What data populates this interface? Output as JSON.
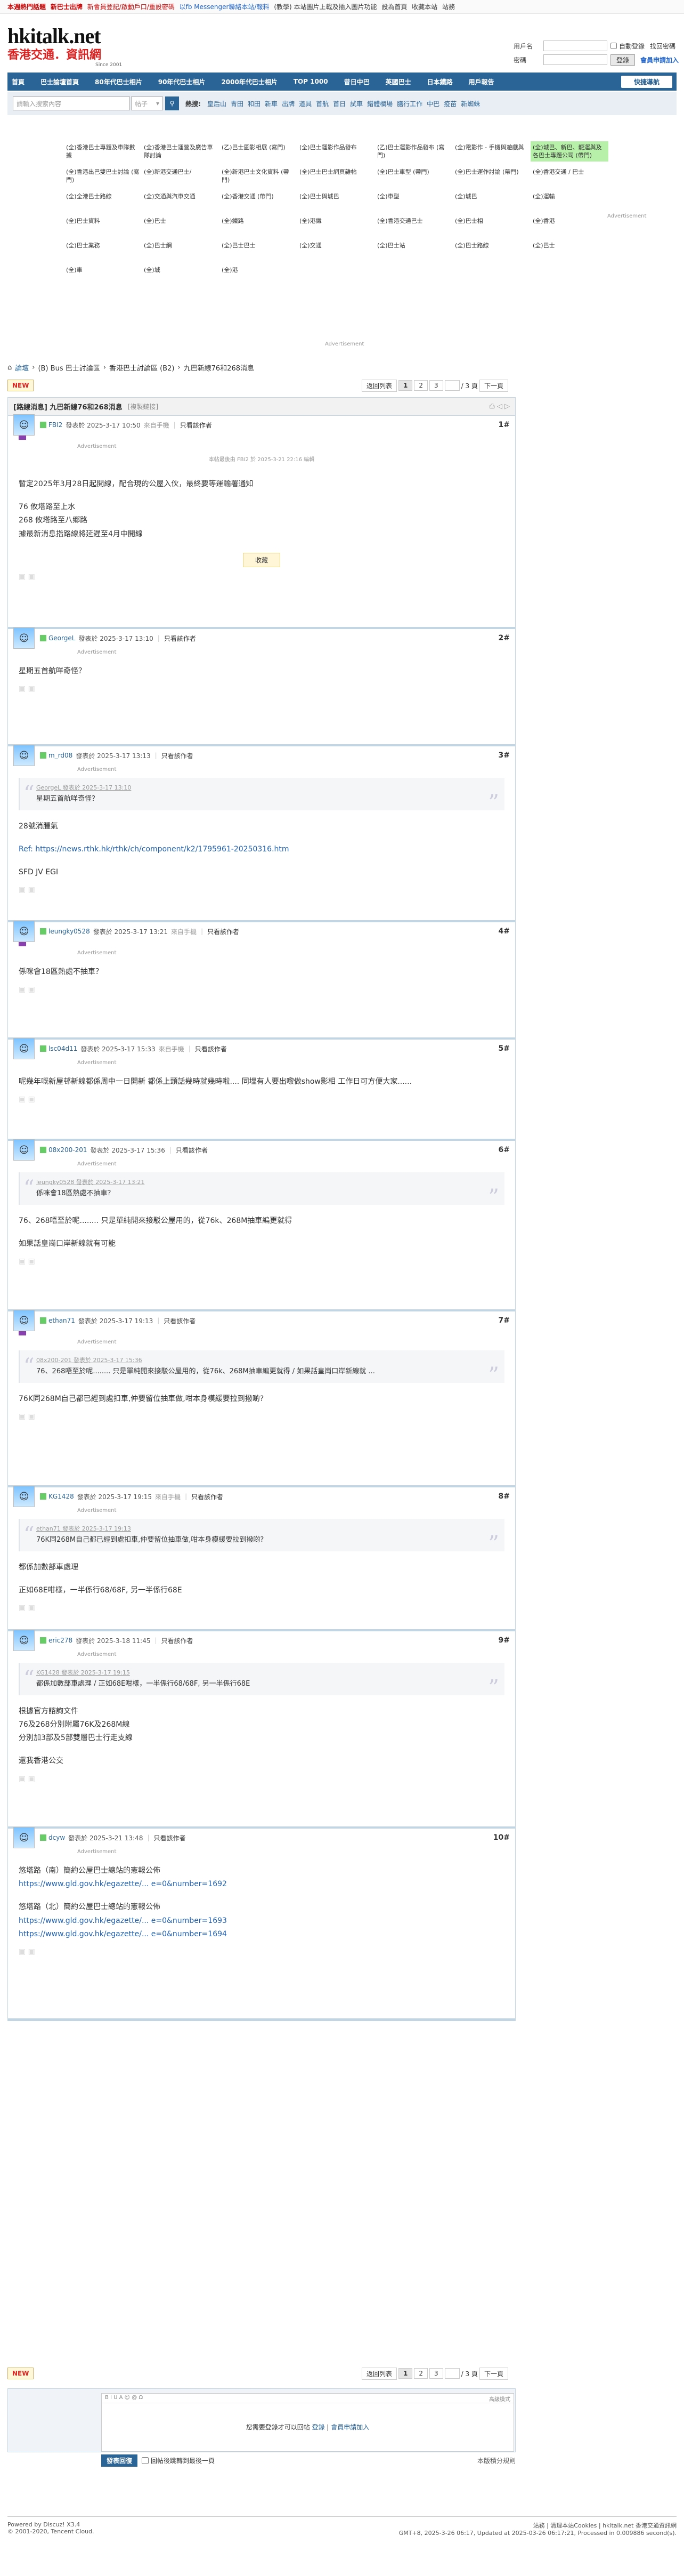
{
  "topbar": {
    "items": [
      "本週熱門話題",
      "新巴士出牌",
      "新會員登記/啟動戶口/重設密碼",
      "以fb Messenger聯絡本站/報料",
      "(教學) 本站圖片上載及插入圖片功能",
      "設為首頁",
      "收藏本站",
      "站務"
    ]
  },
  "logo": {
    "main": "hkitalk.net",
    "sub": "香港交通．資訊網",
    "date": "Since 2001"
  },
  "login": {
    "user_label": "用戶名",
    "pass_label": "密碼",
    "auto": "自動登錄",
    "find": "找回密碼",
    "login_btn": "登錄",
    "register": "會員申請加入"
  },
  "nav": {
    "items": [
      "首頁",
      "巴士論壇首頁",
      "80年代巴士相片",
      "90年代巴士相片",
      "2000年代巴士相片",
      "TOP 1000",
      "昔日中巴",
      "英國巴士",
      "日本鐵路",
      "用戶報告"
    ],
    "quick": "快捷導航"
  },
  "search": {
    "placeholder": "請輸入搜索內容",
    "select": "帖子",
    "hot_label": "熱搜:",
    "hot": [
      "皇后山",
      "青田",
      "和田",
      "新車",
      "出牌",
      "道具",
      "首航",
      "首日",
      "試車",
      "錯體欄場",
      "膳行工作",
      "中巴",
      "疫苗",
      "新蜘蛛"
    ]
  },
  "adlinks": [
    "(全)香港巴士專題及車隊數據",
    "(全)香港巴士運營及廣告車隊討論",
    "(乙)巴士圖影相展 (寫門)",
    "(全)巴士運影作品發布",
    "(乙)巴士運影作品發布 (寫門)",
    "(全)電影作 - 手機與遊戲與",
    "(全)香港出巴雙巴士討論 (寫門)",
    "(全)新港交通巴士/",
    "(全)新港巴士文化資料 (帶門)",
    "(全)巴士巴士網頁雜帖",
    "(全)巴士車型 (帶門)",
    "(全)巴士運作討論 (帶門)",
    "(全)香港交通 / 巴士",
    "(全)全港巴士路線",
    "(全)交通與汽車交通",
    "(全)香港交通 (帶門)",
    "(全)巴士與城巴",
    "(全)車型",
    "(全)城巴",
    "(全)運輸",
    "(全)巴士資料",
    "(全)巴士",
    "(全)鐵路",
    "(全)港鐵",
    "(全)香港交通巴士",
    "(全)巴士相",
    "(全)香港",
    "(全)巴士業務",
    "(全)巴士網",
    "(全)巴士巴士",
    "(全)交通",
    "(全)巴士站",
    "(全)巴士路線",
    "(全)巴士",
    "(全)車",
    "(全)城",
    "(全)港"
  ],
  "adlinks_highlight": "(全)城巴、新巴、龍運與及各巴士專題公司 (帶門)",
  "crumb": {
    "home": "論壇",
    "items": [
      "(B) Bus 巴士討論區",
      "香港巴士討論區 (B2)",
      "九巴新線76和268消息"
    ]
  },
  "pagebar": {
    "new": "NEW",
    "back": "返回列表",
    "pages": [
      "1",
      "2",
      "3"
    ],
    "total": "/ 3 頁",
    "next": "下一頁"
  },
  "thread": {
    "title": "[路線消息] 九巴新線76和268消息",
    "category": "[複製鏈接]"
  },
  "posts": [
    {
      "user": "FBI2",
      "time": "發表於 2025-3-17 10:50",
      "from": "來自手機",
      "only": "只看該作者",
      "floor": "1#",
      "edit": "本帖最後由 FBI2 於 2025-3-21 22:16 編輯",
      "lines": [
        "暫定2025年3月28日起開線，配合現的公屋入伙，最終要等運輸署通知",
        "",
        "76 攸塔路至上水",
        "268 攸塔路至八鄉路",
        "據最新消息指路線將延遲至4月中開線"
      ],
      "collect": "收藏"
    },
    {
      "user": "GeorgeL",
      "time": "發表於 2025-3-17 13:10",
      "only": "只看該作者",
      "floor": "2#",
      "lines": [
        "星期五首航咩奇怪？"
      ]
    },
    {
      "user": "m_rd08",
      "time": "發表於 2025-3-17 13:13",
      "only": "只看該作者",
      "floor": "3#",
      "quote_head": "GeorgeL 發表於 2025-3-17 13:10",
      "quote": "星期五首航咩奇怪？",
      "lines": [
        "28號消腫氣",
        "",
        "Ref: https://news.rthk.hk/rthk/ch/component/k2/1795961-20250316.htm",
        "",
        "SFD JV EGI"
      ]
    },
    {
      "user": "leungky0528",
      "time": "發表於 2025-3-17 13:21",
      "from": "來自手機",
      "only": "只看該作者",
      "floor": "4#",
      "lines": [
        "係咪會18區熱處不抽車？"
      ]
    },
    {
      "user": "lsc04d11",
      "time": "發表於 2025-3-17 15:33",
      "from": "來自手機",
      "only": "只看該作者",
      "floor": "5#",
      "lines": [
        "呢幾年嘅新屋邨新線都係周中一日開新 都係上頭話幾時就幾時啦.... 同埋有人要出嚟做show影相 工作日可方便大家......"
      ]
    },
    {
      "user": "08x200-201",
      "time": "發表於 2025-3-17 15:36",
      "only": "只看該作者",
      "floor": "6#",
      "quote_head": "leungky0528 發表於 2025-3-17 13:21",
      "quote": "係咪會18區熱處不抽車？",
      "lines": [
        "76、268唔至於呢........ 只是單純開來接駁公屋用的，從76k、268M抽車編更就得",
        "",
        "如果話皇崗口岸新線就有可能"
      ]
    },
    {
      "user": "ethan71",
      "time": "發表於 2025-3-17 19:13",
      "only": "只看該作者",
      "floor": "7#",
      "quote_head": "08x200-201 發表於 2025-3-17 15:36",
      "quote": "76、268唔至於呢........ 只是單純開來接駁公屋用的，從76k、268M抽車編更就得 / 如果話皇崗口岸新線就 ...",
      "lines": [
        "76K同268M自己都已經到處扣車,仲要留位抽車做,咁本身模緩要拉到撥啲?"
      ]
    },
    {
      "user": "KG1428",
      "time": "發表於 2025-3-17 19:15",
      "from": "來自手機",
      "only": "只看該作者",
      "floor": "8#",
      "quote_head": "ethan71 發表於 2025-3-17 19:13",
      "quote": "76K同268M自己都已經到處扣車,仲要留位抽車做,咁本身模緩要拉到撥啲?",
      "lines": [
        "都係加數部車處理",
        "",
        "正如68E咁樣，一半係行68/68F, 另一半係行68E"
      ]
    },
    {
      "user": "eric278",
      "time": "發表於 2025-3-18 11:45",
      "only": "只看該作者",
      "floor": "9#",
      "quote_head": "KG1428 發表於 2025-3-17 19:15",
      "quote": "都係加數部車處理 / 正如68E咁樣，一半係行68/68F, 另一半係行68E",
      "lines": [
        "根據官方諮詢文件",
        "76及268分別附屬76K及268M線",
        "分別加3部及5部雙層巴士行走支線",
        "",
        "還我香港公交"
      ]
    },
    {
      "user": "dcyw",
      "time": "發表於 2025-3-21 13:48",
      "only": "只看該作者",
      "floor": "10#",
      "lines": [
        "悠塔路（南）簡約公屋巴士總站的憲報公佈",
        "https://www.gld.gov.hk/egazette/... e=0&number=1692",
        "",
        "悠塔路（北）簡約公屋巴士總站的憲報公佈",
        "https://www.gld.gov.hk/egazette/... e=0&number=1693",
        "https://www.gld.gov.hk/egazette/... e=0&number=1694"
      ]
    }
  ],
  "reply": {
    "toolbar": "B  I  U  A  ☺  @  Ω",
    "mode": "高級模式",
    "msg_prefix": "您需要登錄才可以回帖",
    "login": "登錄",
    "sep": " | ",
    "register": "會員申請加入",
    "post_btn": "發表回復",
    "notify": "回帖後跳轉到最後一頁",
    "rules": "本版積分規則"
  },
  "footer": {
    "powered": "Powered by Discuz! X3.4",
    "copy": "© 2001-2020, Tencent Cloud.",
    "links": "站務 | 清理本站Cookies | hkitalk.net 香港交通資訊網",
    "gmt": "GMT+8, 2025-3-26 06:17, Updated at 2025-03-26 06:17:21, Processed in 0.009886 second(s)."
  },
  "advert": "Advertisement"
}
